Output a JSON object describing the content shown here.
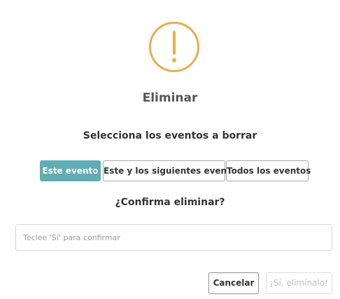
{
  "dialog": {
    "icon": "warning-exclamation-icon",
    "icon_color": "#e8ad4c",
    "title": "Eliminar",
    "subtitle": "Selecciona los eventos a borrar",
    "scope_options": {
      "this_event": "Este evento",
      "this_and_following": "Este y los siguientes eventos",
      "all_events": "Todos los eventos",
      "selected": "Este evento"
    },
    "accent_color": "#5fadb5",
    "confirm_question": "¿Confirma eliminar?",
    "confirm_input": {
      "value": "",
      "placeholder": "Teclee 'Sí' para confirmar"
    },
    "buttons": {
      "cancel": "Cancelar",
      "confirm_delete": "¡Sí, elimínalo!"
    }
  }
}
